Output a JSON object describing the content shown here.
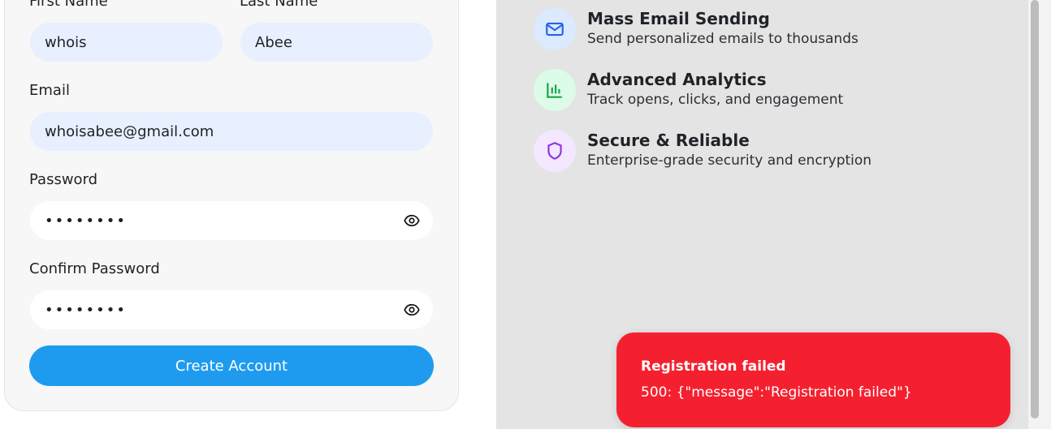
{
  "form": {
    "first_name_label": "First Name",
    "first_name_value": "whois",
    "last_name_label": "Last Name",
    "last_name_value": "Abee",
    "email_label": "Email",
    "email_value": "whoisabee@gmail.com",
    "password_label": "Password",
    "password_value": "••••••••",
    "confirm_password_label": "Confirm Password",
    "confirm_password_value": "••••••••",
    "submit_label": "Create Account"
  },
  "features": [
    {
      "title": "Mass Email Sending",
      "desc": "Send personalized emails to thousands",
      "icon": "mail-icon",
      "icon_color": "#2563eb",
      "bg_color": "#dbeafe"
    },
    {
      "title": "Advanced Analytics",
      "desc": "Track opens, clicks, and engagement",
      "icon": "chart-icon",
      "icon_color": "#16a34a",
      "bg_color": "#dcfce7"
    },
    {
      "title": "Secure & Reliable",
      "desc": "Enterprise-grade security and encryption",
      "icon": "shield-icon",
      "icon_color": "#9333ea",
      "bg_color": "#f3e8ff"
    }
  ],
  "toast": {
    "title": "Registration failed",
    "message": "500: {\"message\":\"Registration failed\"}",
    "color": "#f5202f"
  },
  "colors": {
    "primary": "#1e9bef",
    "input_bg": "#e8efff"
  }
}
